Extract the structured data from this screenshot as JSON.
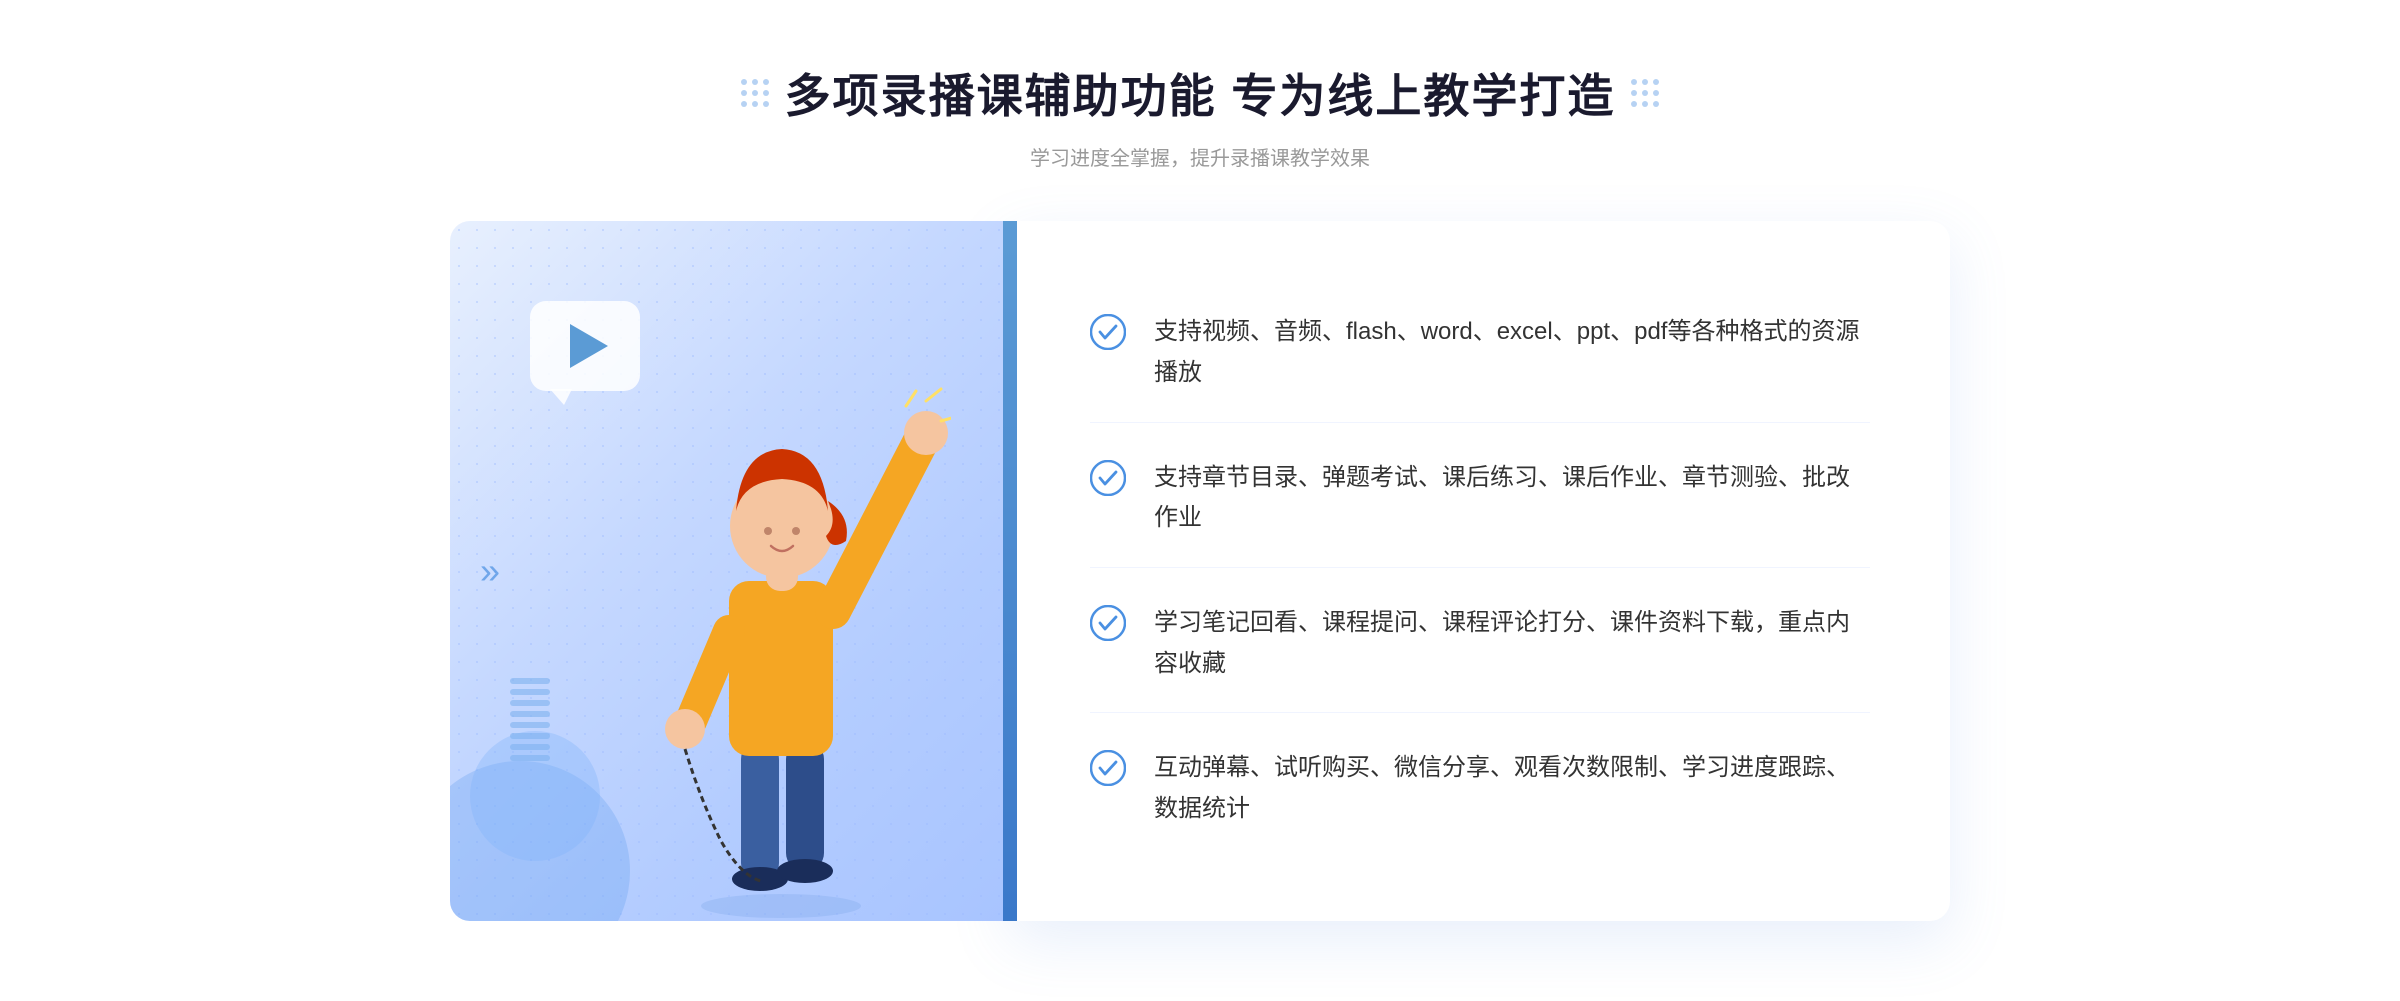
{
  "header": {
    "title": "多项录播课辅助功能 专为线上教学打造",
    "subtitle": "学习进度全掌握，提升录播课教学效果"
  },
  "features": [
    {
      "id": 1,
      "text": "支持视频、音频、flash、word、excel、ppt、pdf等各种格式的资源播放"
    },
    {
      "id": 2,
      "text": "支持章节目录、弹题考试、课后练习、课后作业、章节测验、批改作业"
    },
    {
      "id": 3,
      "text": "学习笔记回看、课程提问、课程评论打分、课件资料下载，重点内容收藏"
    },
    {
      "id": 4,
      "text": "互动弹幕、试听购买、微信分享、观看次数限制、学习进度跟踪、数据统计"
    }
  ],
  "icons": {
    "check": "check-circle-icon",
    "dots_left": "decorative-dots-left",
    "dots_right": "decorative-dots-right"
  },
  "colors": {
    "accent": "#4a90e2",
    "title": "#1a1a2e",
    "subtitle": "#999999",
    "feature_text": "#333333",
    "border": "#f0f4ff"
  }
}
